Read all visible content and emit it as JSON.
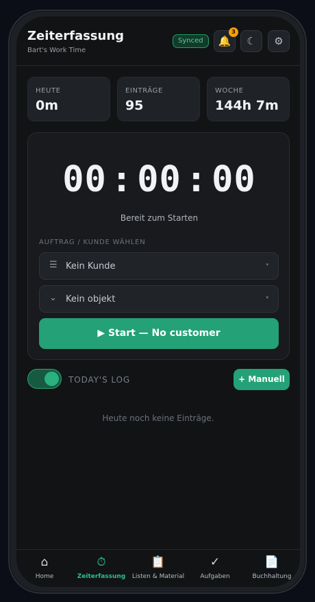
{
  "header": {
    "title": "Zeiterfassung",
    "subtitle": "Bart's Work Time",
    "sync_status": "Synced",
    "notification_count": "3",
    "icons": {
      "bell": "🔔",
      "moon": "☾",
      "gear": "⚙"
    }
  },
  "stats": [
    {
      "label": "HEUTE",
      "value": "0m"
    },
    {
      "label": "EINTRÄGE",
      "value": "95"
    },
    {
      "label": "WOCHE",
      "value": "144h 7m"
    }
  ],
  "timer": {
    "hours": "00",
    "minutes": "00",
    "seconds": "00",
    "separator": ":",
    "status": "Bereit zum Starten",
    "section_label": "AUFTRAG / KUNDE WÄHLEN",
    "customer_select": {
      "icon": "☰",
      "value": "Kein Kunde"
    },
    "object_select": {
      "icon": "⌄",
      "value": "Kein objekt"
    },
    "caret": "▾",
    "start_label": "▶ Start — No customer"
  },
  "log": {
    "title": "TODAY'S LOG",
    "manual_label": "+ Manuell",
    "empty_text": "Heute noch keine Einträge.",
    "toggle_on": true
  },
  "nav": {
    "items": [
      {
        "icon": "⌂",
        "label": "Home"
      },
      {
        "icon": "⏱",
        "label": "Zeiterfassung"
      },
      {
        "icon": "📋",
        "label": "Listen & Material"
      },
      {
        "icon": "✓",
        "label": "Aufgaben"
      },
      {
        "icon": "📄",
        "label": "Buchhaltung"
      }
    ],
    "active_index": 1
  },
  "colors": {
    "accent": "#24a176",
    "background": "#111315",
    "card": "#1f2226",
    "badge": "#f59e0b"
  }
}
